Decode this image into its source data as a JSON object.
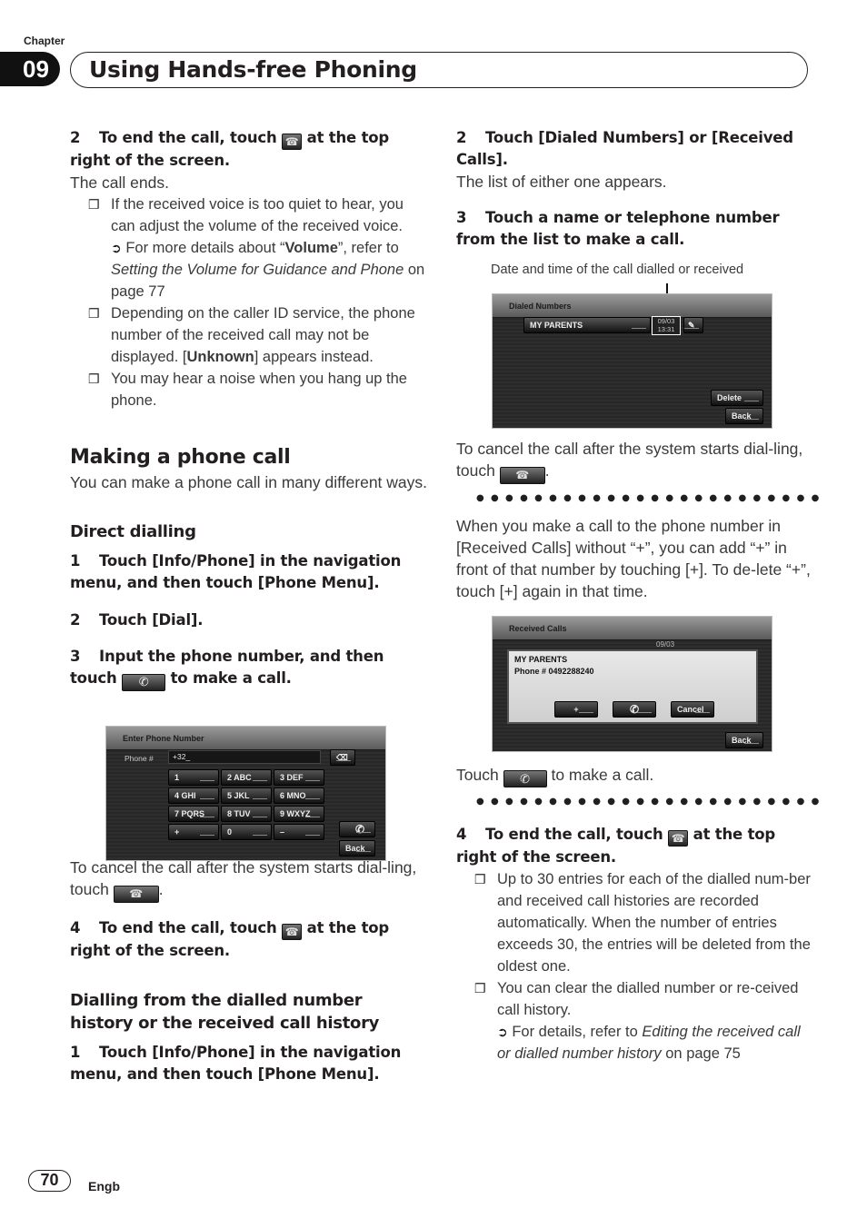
{
  "header": {
    "chapter_label": "Chapter",
    "chapter_number": "09",
    "title": "Using Hands-free Phoning"
  },
  "left": {
    "step2": {
      "num": "2",
      "before": "To end the call, touch",
      "after": "at the top right of the screen."
    },
    "call_ends": "The call ends.",
    "note1": {
      "text": "If the received voice is too quiet to hear, you can adjust the volume of the received voice.",
      "ref_pre": "For more details about “",
      "ref_bold": "Volume",
      "ref_mid": "”, refer to ",
      "ref_italic": "Setting the Volume for Guidance and Phone",
      "ref_post": " on page 77"
    },
    "note2": {
      "pre": "Depending on the caller ID service, the phone number of the received call may not be displayed. [",
      "bold": "Unknown",
      "post": "] appears instead."
    },
    "note3": "You may hear a noise when you hang up the phone.",
    "section_title": "Making a phone call",
    "section_intro": "You can make a phone call in many different ways.",
    "direct_title": "Direct dialling",
    "d_step1": {
      "num": "1",
      "text": "Touch [Info/Phone] in the navigation menu, and then touch [Phone Menu]."
    },
    "d_step2": {
      "num": "2",
      "text": "Touch [Dial]."
    },
    "d_step3": {
      "num": "3",
      "before": "Input the phone number, and then touch",
      "after": "to make a call."
    },
    "cancel_text_pre": "To cancel the call after the system starts dial-ling, touch",
    "d_step4": {
      "num": "4",
      "before": "To end the call, touch",
      "after": "at the top right of the screen."
    },
    "history_title": "Dialling from the dialled number history or the received call history",
    "h_step1": {
      "num": "1",
      "text": "Touch [Info/Phone] in the navigation menu, and then touch [Phone Menu]."
    }
  },
  "screen_enter": {
    "title": "Enter Phone Number",
    "field_label": "Phone #",
    "field_value": "+32_",
    "keys": [
      "1",
      "2 ABC",
      "3 DEF",
      "4 GHI",
      "5 JKL",
      "6 MNO",
      "7 PQRS",
      "8 TUV",
      "9 WXYZ",
      "+",
      "0",
      "–"
    ],
    "back": "Back"
  },
  "right": {
    "step2": {
      "num": "2",
      "text": "Touch [Dialed Numbers] or [Received Calls]."
    },
    "list_appears": "The list of either one appears.",
    "step3": {
      "num": "3",
      "text": "Touch a name or telephone number from the list to make a call."
    },
    "caption": "Date and time of the call dialled or received",
    "cancel_text_pre": "To cancel the call after the system starts dial-ling, touch",
    "dots": "●●●●●●●●●●●●●●●●●●●●●●●●",
    "plus_para": {
      "a": "When you make a call to the phone number in [",
      "b": "Received Calls",
      "c": "] without “",
      "d": "+",
      "e": "”, you can add “",
      "f": "+",
      "g": "” in front of that number by touching [",
      "h": "+",
      "i": "]. To de-lete “",
      "j": "+",
      "k": "”, touch [",
      "l": "+",
      "m": "] again in that time."
    },
    "touch_pre": "Touch",
    "touch_post": "to make a call.",
    "step4": {
      "num": "4",
      "before": "To end the call, touch",
      "after": "at the top right of the screen."
    },
    "note1": "Up to 30 entries for each of the dialled num-ber and received call histories are recorded automatically. When the number of entries exceeds 30, the entries will be deleted from the oldest one.",
    "note2": "You can clear the dialled number or re-ceived call history.",
    "note2_ref_pre": "For details, refer to ",
    "note2_ref_italic": "Editing the received call or dialled number history",
    "note2_ref_post": " on page 75"
  },
  "screen_dialed": {
    "title": "Dialed Numbers",
    "entry_name": "MY PARENTS",
    "entry_date": "09/03",
    "entry_time": "13:31",
    "delete": "Delete",
    "back": "Back"
  },
  "screen_received": {
    "title": "Received Calls",
    "bg_entry_date": "09/03",
    "popup_name": "MY PARENTS",
    "popup_phone": "Phone # 0492288240",
    "plus": "+",
    "cancel": "Cancel",
    "back": "Back"
  },
  "footer": {
    "page": "70",
    "lang": "Engb"
  }
}
